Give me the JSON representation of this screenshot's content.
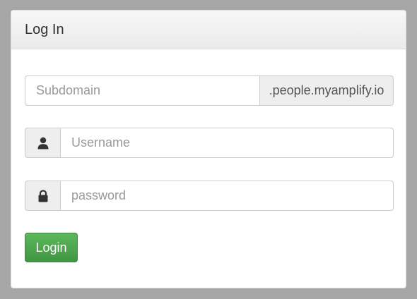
{
  "panel": {
    "title": "Log In"
  },
  "subdomain": {
    "placeholder": "Subdomain",
    "value": "",
    "suffix": ".people.myamplify.io"
  },
  "username": {
    "placeholder": "Username",
    "value": "",
    "icon": "user-icon"
  },
  "password": {
    "placeholder": "password",
    "value": "",
    "icon": "lock-icon"
  },
  "login_button": {
    "label": "Login",
    "color": "#4cae4c"
  },
  "colors": {
    "background": "#a6a6a6",
    "panel_heading": "#f2f2f2",
    "addon": "#eeeeee"
  }
}
